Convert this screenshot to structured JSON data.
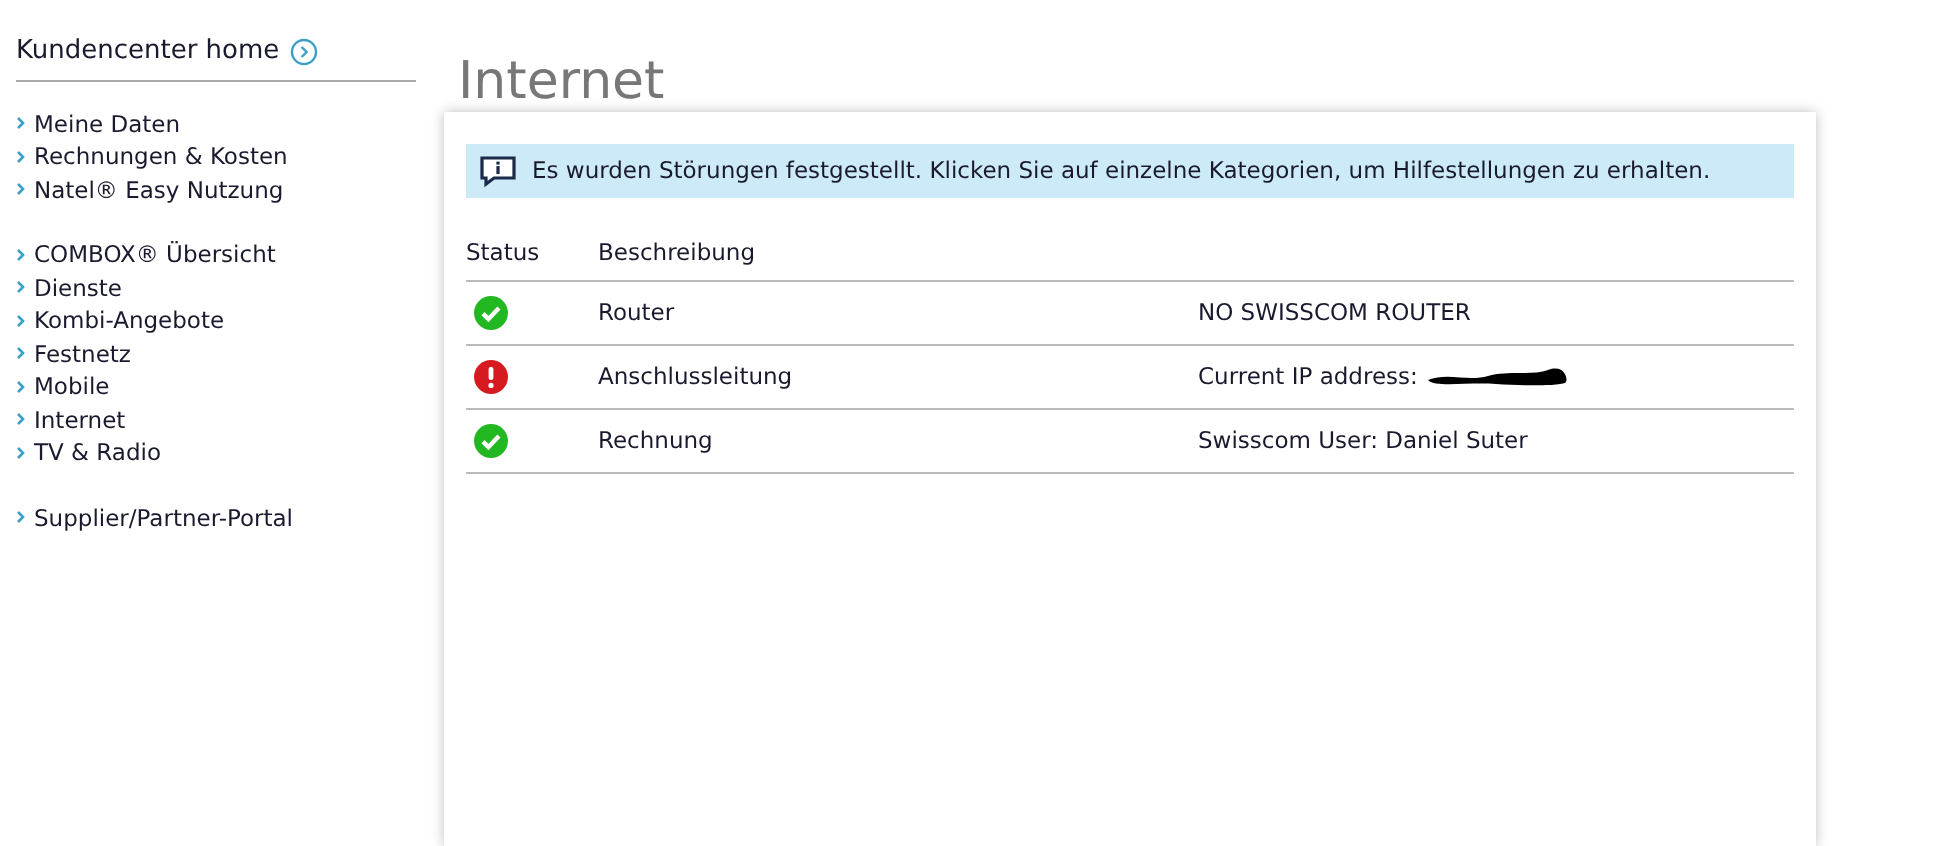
{
  "sidebar": {
    "home": "Kundencenter home",
    "groups": [
      {
        "items": [
          "Meine Daten",
          "Rechnungen & Kosten",
          "Natel® Easy Nutzung"
        ]
      },
      {
        "items": [
          "COMBOX® Übersicht",
          "Dienste",
          "Kombi-Angebote",
          "Festnetz",
          "Mobile",
          "Internet",
          "TV & Radio"
        ]
      },
      {
        "items": [
          "Supplier/Partner-Portal"
        ]
      }
    ]
  },
  "page": {
    "title": "Internet",
    "notice": "Es wurden Störungen festgestellt. Klicken Sie auf einzelne Kategorien, um Hilfestellungen zu erhalten."
  },
  "table": {
    "columns": [
      "Status",
      "Beschreibung"
    ],
    "rows": [
      {
        "kind": "ok",
        "description": "Router",
        "detail": "NO SWISSCOM ROUTER",
        "redacted": false
      },
      {
        "kind": "error",
        "description": "Anschlussleitung",
        "detail": "Current IP address:",
        "redacted": true
      },
      {
        "kind": "ok",
        "description": "Rechnung",
        "detail": "Swisscom User: Daniel Suter",
        "redacted": false
      }
    ]
  }
}
